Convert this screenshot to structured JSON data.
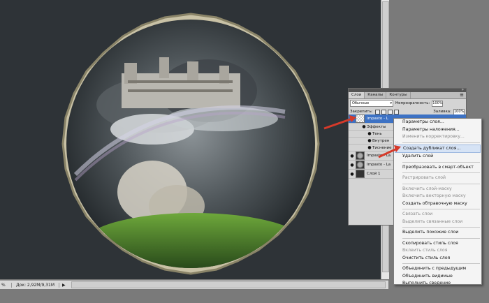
{
  "status_bar": {
    "zoom": "%",
    "doc_info": "Док: 2,92M/9,31M"
  },
  "layers_panel": {
    "tabs": [
      {
        "label": "Слои"
      },
      {
        "label": "Каналы"
      },
      {
        "label": "Контуры"
      }
    ],
    "blend_mode": "Обычные",
    "opacity_label": "Непрозрачность:",
    "opacity_value": "100%",
    "lock_label": "Закрепить:",
    "fill_label": "Заливка:",
    "fill_value": "100%",
    "layers": [
      {
        "name": "Impasto - L",
        "selected": true,
        "fx": true
      },
      {
        "name": "Эффекты",
        "sub": true
      },
      {
        "name": "Тень",
        "sub": true
      },
      {
        "name": "Внутрен",
        "sub": true
      },
      {
        "name": "Тиснение",
        "sub": true
      },
      {
        "name": "Impasto - La",
        "fx": false
      },
      {
        "name": "Impasto - La",
        "fx": false
      },
      {
        "name": "Слой 1",
        "fx": false
      }
    ]
  },
  "context_menu": {
    "items": [
      {
        "label": "Параметры слоя...",
        "enabled": true
      },
      {
        "label": "Параметры наложения...",
        "enabled": true
      },
      {
        "label": "Изменить корректировку...",
        "enabled": false
      },
      {
        "sep": true
      },
      {
        "label": "Создать дубликат слоя...",
        "enabled": true,
        "highlight": true
      },
      {
        "label": "Удалить слой",
        "enabled": true
      },
      {
        "sep": true
      },
      {
        "label": "Преобразовать в смарт-объект",
        "enabled": true
      },
      {
        "sep": true
      },
      {
        "label": "Растрировать слой",
        "enabled": false
      },
      {
        "sep": true
      },
      {
        "label": "Включить слой-маску",
        "enabled": false
      },
      {
        "label": "Включить векторную маску",
        "enabled": false
      },
      {
        "label": "Создать обтравочную маску",
        "enabled": true
      },
      {
        "sep": true
      },
      {
        "label": "Связать слои",
        "enabled": false
      },
      {
        "label": "Выделить связанные слои",
        "enabled": false
      },
      {
        "sep": true
      },
      {
        "label": "Выделить похожие слои",
        "enabled": true
      },
      {
        "sep": true
      },
      {
        "label": "Скопировать стиль слоя",
        "enabled": true
      },
      {
        "label": "Вклеить стиль слоя",
        "enabled": false
      },
      {
        "label": "Очистить стиль слоя",
        "enabled": true
      },
      {
        "sep": true
      },
      {
        "label": "Объединить с предыдущим",
        "enabled": true
      },
      {
        "label": "Объединить видимые",
        "enabled": true
      },
      {
        "label": "Выполнить сведение",
        "enabled": true
      }
    ]
  }
}
